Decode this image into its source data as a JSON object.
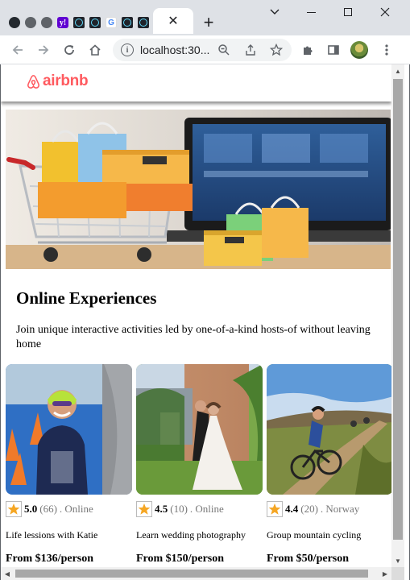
{
  "browser": {
    "tabs": [
      {
        "icon": "github-icon"
      },
      {
        "icon": "globe-icon"
      },
      {
        "icon": "globe-icon"
      },
      {
        "icon": "yahoo-icon",
        "glyph": "y!"
      },
      {
        "icon": "react-icon"
      },
      {
        "icon": "react-icon"
      },
      {
        "icon": "google-icon",
        "glyph": "G"
      },
      {
        "icon": "react-icon"
      },
      {
        "icon": "react-icon"
      }
    ],
    "active_tab_close": "✕",
    "new_tab": "+",
    "url": "localhost:30..."
  },
  "site": {
    "brand": "airbnb",
    "brand_color": "#ff5a5f"
  },
  "section": {
    "title": "Online Experiences",
    "description": "Join unique interactive activities led by one-of-a-kind hosts-of without leaving home"
  },
  "cards": [
    {
      "rating": "5.0",
      "count": "(66)",
      "location": ". Online",
      "title": "Life lessions with Katie",
      "price": "From $136/person"
    },
    {
      "rating": "4.5",
      "count": "(10)",
      "location": ". Online",
      "title": "Learn wedding photography",
      "price": "From $150/person"
    },
    {
      "rating": "4.4",
      "count": "(20)",
      "location": ". Norway",
      "title": "Group mountain cycling",
      "price": "From $50/person"
    }
  ],
  "colors": {
    "star": "#f5a623"
  }
}
